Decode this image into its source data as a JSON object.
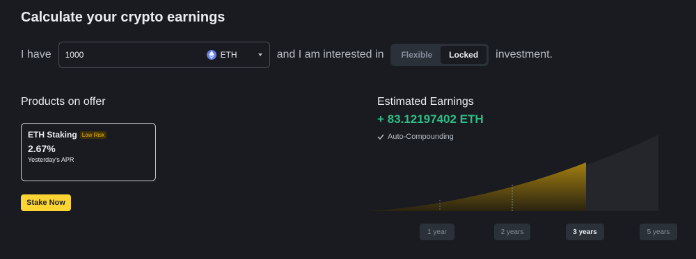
{
  "page": {
    "title": "Calculate your crypto earnings"
  },
  "sentence": {
    "prefix": "I have",
    "amount": "1000",
    "coin": "ETH",
    "middle": "and I am interested in",
    "suffix": "investment."
  },
  "investment_types": [
    {
      "label": "Flexible",
      "selected": false
    },
    {
      "label": "Locked",
      "selected": true
    }
  ],
  "products": {
    "title": "Products on offer",
    "card": {
      "name": "ETH Staking",
      "risk": "Low Risk",
      "apr": "2.67%",
      "apr_label": "Yesterday's APR"
    },
    "cta": "Stake Now"
  },
  "earnings": {
    "title": "Estimated Earnings",
    "value": "+ 83.12197402 ETH",
    "compounding": "Auto-Compounding"
  },
  "periods": [
    {
      "label": "1 year",
      "selected": false
    },
    {
      "label": "2 years",
      "selected": false
    },
    {
      "label": "3 years",
      "selected": true
    },
    {
      "label": "5 years",
      "selected": false
    }
  ],
  "colors": {
    "accent": "#fcd535",
    "positive": "#2ebd85",
    "eth": "#627eea"
  },
  "icons": {
    "coin": "eth-icon",
    "dropdown": "caret-down-icon",
    "check": "check-icon"
  }
}
